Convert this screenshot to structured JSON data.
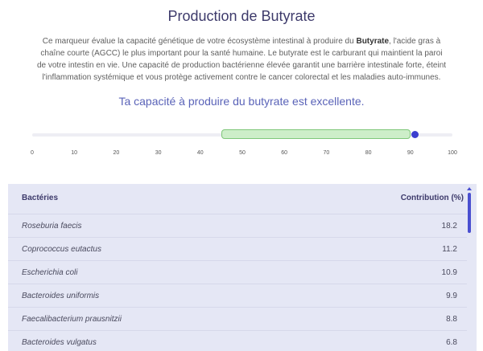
{
  "header": {
    "title": "Production de Butyrate",
    "description_parts": [
      {
        "text": "Ce marqueur évalue la capacité génétique de votre écosystème intestinal à produire du ",
        "bold": false
      },
      {
        "text": "Butyrate",
        "bold": true
      },
      {
        "text": ", l'acide gras à chaîne courte (AGCC) le plus important pour la santé humaine. Le butyrate est le carburant qui maintient la paroi de votre intestin en vie. Une capacité de production bactérienne élevée garantit une barrière intestinale forte, éteint l'inflammation systémique et vous protège activement contre le cancer colorectal et les maladies auto-immunes.",
        "bold": false
      }
    ],
    "verdict": "Ta capacité à produire du butyrate est excellente."
  },
  "gauge": {
    "min": 0,
    "max": 100,
    "ticks": [
      "0",
      "10",
      "20",
      "30",
      "40",
      "50",
      "60",
      "70",
      "80",
      "90",
      "100"
    ],
    "optimal_range": [
      45,
      90
    ],
    "value": 91,
    "colors": {
      "range_fill": "#cdeec9",
      "range_border": "#7fc77a",
      "marker": "#3b3fcf"
    }
  },
  "table": {
    "headers": {
      "name": "Bactéries",
      "value": "Contribution (%)"
    },
    "rows": [
      {
        "name": "Roseburia faecis",
        "value": "18.2"
      },
      {
        "name": "Coprococcus eutactus",
        "value": "11.2"
      },
      {
        "name": "Escherichia coli",
        "value": "10.9"
      },
      {
        "name": "Bacteroides uniformis",
        "value": "9.9"
      },
      {
        "name": "Faecalibacterium prausnitzii",
        "value": "8.8"
      },
      {
        "name": "Bacteroides vulgatus",
        "value": "6.8"
      }
    ]
  }
}
